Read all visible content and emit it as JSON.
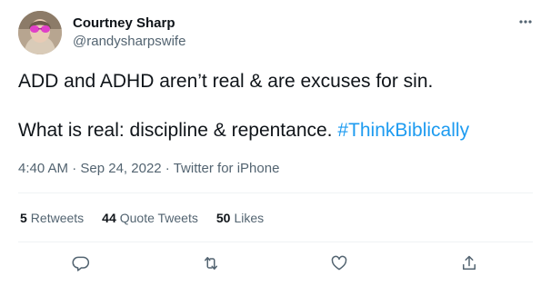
{
  "author": {
    "display_name": "Courtney Sharp",
    "handle": "@randysharpswife",
    "avatar_icon": "user-avatar"
  },
  "tweet": {
    "line1": "ADD and ADHD aren’t real & are excuses for sin.",
    "line2_text": "What is real: discipline & repentance. ",
    "hashtag": "#ThinkBiblically"
  },
  "meta": {
    "time": "4:40 AM",
    "separator1": " · ",
    "date": "Sep 24, 2022",
    "separator2": " · ",
    "source": "Twitter for iPhone"
  },
  "stats": {
    "retweets_count": "5",
    "retweets_label": "Retweets",
    "quote_count": "44",
    "quote_label": "Quote Tweets",
    "likes_count": "50",
    "likes_label": "Likes"
  },
  "actions": {
    "reply_icon": "reply-icon",
    "retweet_icon": "retweet-icon",
    "like_icon": "heart-icon",
    "share_icon": "share-icon"
  },
  "colors": {
    "text": "#0f1419",
    "muted": "#536471",
    "accent": "#1d9bf0",
    "divider": "#eff3f4"
  }
}
